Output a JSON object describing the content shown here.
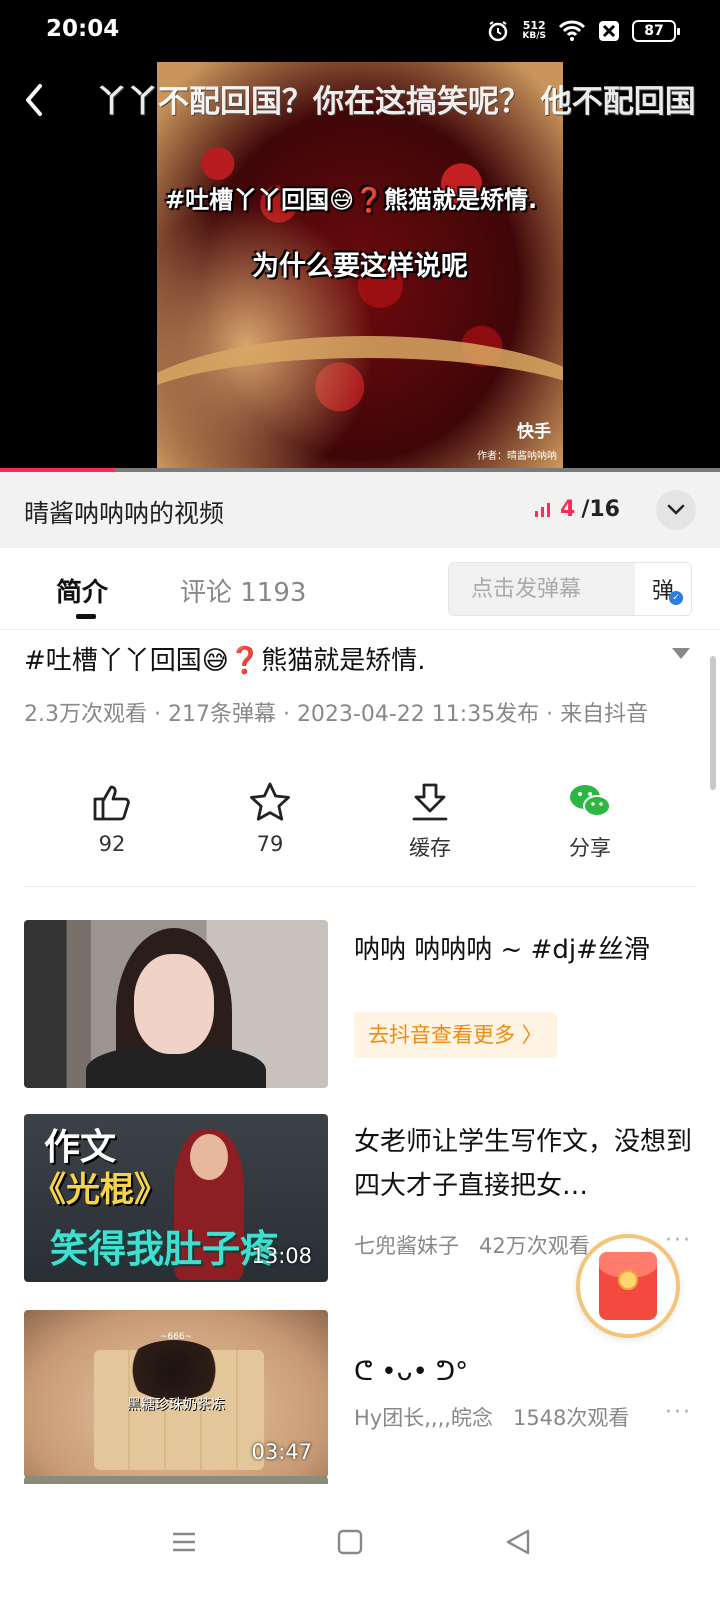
{
  "status_bar": {
    "time": "20:04",
    "net_speed_value": "512",
    "net_speed_unit": "KB/S",
    "battery": "87"
  },
  "player": {
    "danmaku_text": "丫丫不配回国？你在这搞笑呢？ 他不配回国",
    "caption_line1": "#吐槽丫丫回国😅❓熊猫就是矫情.",
    "caption_line2": "为什么要这样说呢",
    "logo_text": "快手",
    "author_text": "作者：晴酱呐呐呐",
    "progress_fraction": 0.16
  },
  "playlist": {
    "title": "晴酱呐呐呐的视频",
    "current": "4",
    "total": "/16"
  },
  "tabs": {
    "intro": "简介",
    "comments": "评论 1193",
    "danmaku_placeholder": "点击发弹幕",
    "danmaku_toggle": "弹"
  },
  "video": {
    "title": "#吐槽丫丫回国😅❓熊猫就是矫情.",
    "meta": "2.3万次观看 · 217条弹幕 · 2023-04-22 11:35发布 · 来自抖音"
  },
  "actions": [
    {
      "label": "92",
      "icon": "thumbs-up-icon"
    },
    {
      "label": "79",
      "icon": "star-icon"
    },
    {
      "label": "缓存",
      "icon": "download-icon"
    },
    {
      "label": "分享",
      "icon": "wechat-icon"
    }
  ],
  "recommendations": [
    {
      "title": "呐呐 呐呐呐 ~ #dj#丝滑",
      "button": "去抖音查看更多 〉"
    },
    {
      "title": "女老师让学生写作文，没想到四大才子直接把女…",
      "author": "七兜酱妹子",
      "views": "42万次观看",
      "duration": "13:08",
      "thumb_text1": "作文",
      "thumb_text2": "《光棍》",
      "thumb_text3": "笑得我肚子疼"
    },
    {
      "title": "ᕦ •ᴗ• ᕤ°",
      "author": "Hy团长,,,,皖念",
      "views": "1548次观看",
      "duration": "03:47",
      "thumb_caption": "黑糖珍珠奶茶冻",
      "thumb_tag": "~666~"
    }
  ],
  "more_glyph": "···",
  "colors": {
    "accent": "#fe2c55",
    "orange": "#ee8b14",
    "wechat": "#2bb741"
  }
}
